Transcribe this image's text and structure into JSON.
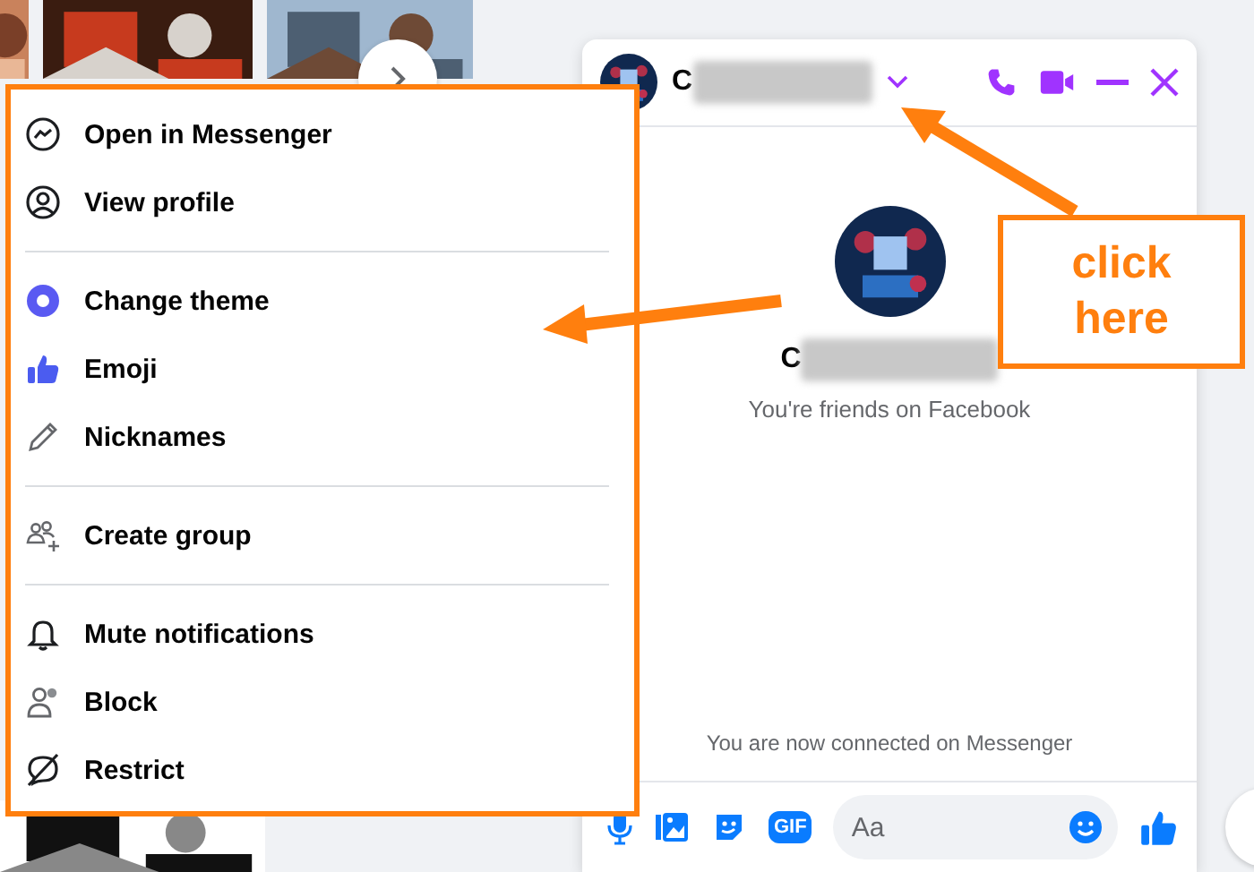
{
  "chat_window": {
    "header": {
      "name": "C"
    },
    "profile": {
      "name": "C",
      "note": "You're friends on Facebook"
    },
    "system_message": "You are now connected on Messenger",
    "composer": {
      "gif_label": "GIF",
      "placeholder": "Aa"
    }
  },
  "menu": {
    "sections": [
      {
        "items": [
          {
            "label": "Open in Messenger"
          },
          {
            "label": "View profile"
          }
        ]
      },
      {
        "items": [
          {
            "label": "Change theme"
          },
          {
            "label": "Emoji"
          },
          {
            "label": "Nicknames"
          }
        ]
      },
      {
        "items": [
          {
            "label": "Create group"
          }
        ]
      },
      {
        "items": [
          {
            "label": "Mute notifications"
          },
          {
            "label": "Block"
          },
          {
            "label": "Restrict"
          }
        ]
      }
    ]
  },
  "callout": {
    "text": "click here"
  }
}
